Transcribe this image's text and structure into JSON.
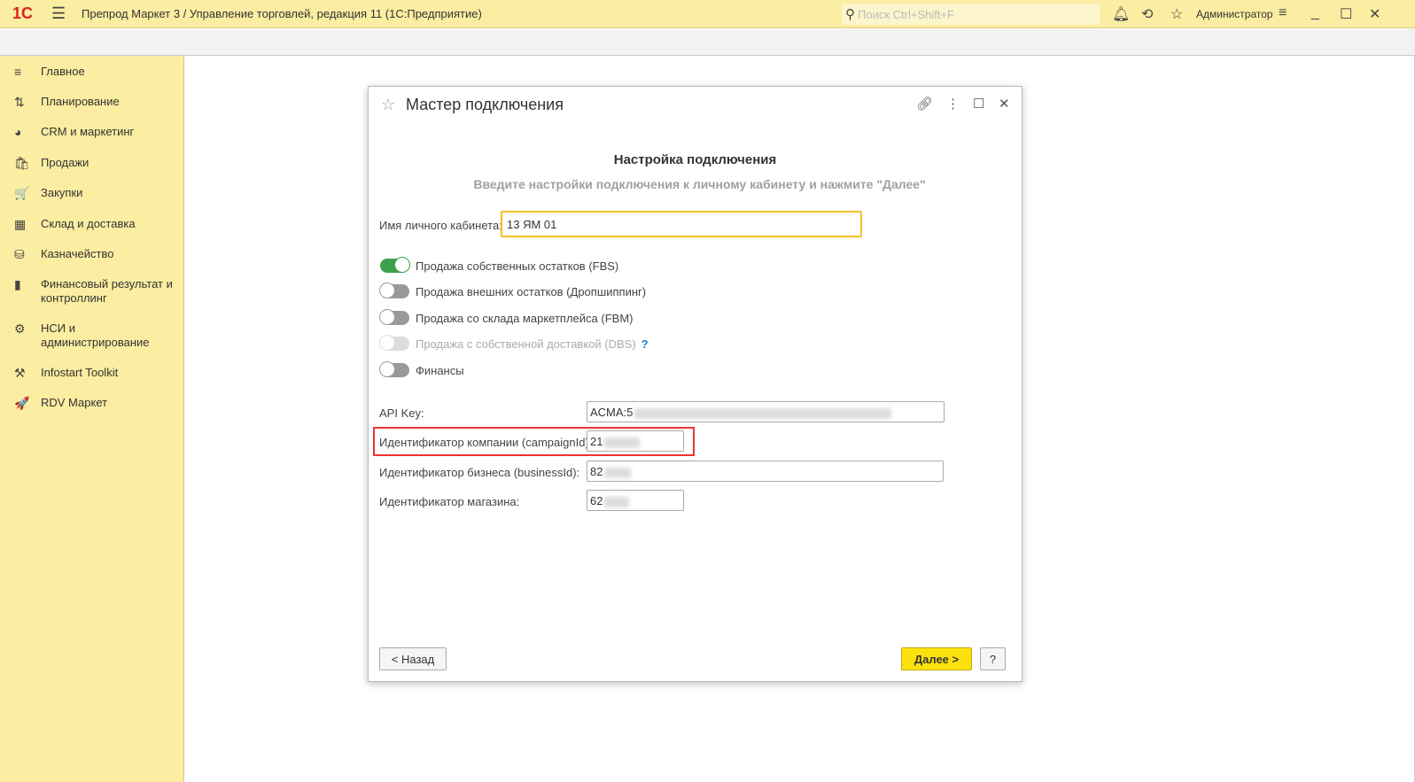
{
  "app": {
    "logo": "1С",
    "title": "Препрод Маркет 3 / Управление торговлей, редакция 11  (1С:Предприятие)",
    "search_placeholder": "Поиск Ctrl+Shift+F",
    "user": "Администратор"
  },
  "sidebar": {
    "items": [
      {
        "label": "Главное",
        "icon": "≡"
      },
      {
        "label": "Планирование",
        "icon": "⇅"
      },
      {
        "label": "CRM и маркетинг",
        "icon": "◕"
      },
      {
        "label": "Продажи",
        "icon": "🛍"
      },
      {
        "label": "Закупки",
        "icon": "🛒"
      },
      {
        "label": "Склад и доставка",
        "icon": "▦"
      },
      {
        "label": "Казначейство",
        "icon": "⛁"
      },
      {
        "label": "Финансовый результат и контроллинг",
        "icon": "▮"
      },
      {
        "label": "НСИ и администрирование",
        "icon": "⚙"
      },
      {
        "label": "Infostart Toolkit",
        "icon": "⚒"
      },
      {
        "label": "RDV Маркет",
        "icon": "🚀"
      }
    ]
  },
  "dialog": {
    "title": "Мастер подключения",
    "heading": "Настройка подключения",
    "subheading": "Введите настройки подключения к личному кабинету и нажмите \"Далее\"",
    "cabinet_label": "Имя личного кабинета:",
    "cabinet_value": "13 ЯМ 01",
    "toggles": [
      {
        "label": "Продажа собственных остатков (FBS)",
        "on": true,
        "disabled": false
      },
      {
        "label": "Продажа внешних остатков (Дропшиппинг)",
        "on": false,
        "disabled": false
      },
      {
        "label": "Продажа со склада маркетплейса (FBM)",
        "on": false,
        "disabled": false
      },
      {
        "label": "Продажа с собственной доставкой (DBS)",
        "on": false,
        "disabled": true
      },
      {
        "label": "Финансы",
        "on": false,
        "disabled": false
      }
    ],
    "help_mark": "?",
    "fields": [
      {
        "label": "API Key:",
        "value": "ACMA:5"
      },
      {
        "label": "Идентификатор компании (campaignId):",
        "value": "21"
      },
      {
        "label": "Идентификатор бизнеса (businessId):",
        "value": "82"
      },
      {
        "label": "Идентификатор магазина:",
        "value": "62"
      }
    ],
    "back_label": "< Назад",
    "next_label": "Далее >",
    "help_label": "?"
  },
  "colors": {
    "accent": "#fbe20d",
    "panel": "#fbeda1",
    "toggle_on": "#3ca04a",
    "highlight": "#e33333"
  }
}
